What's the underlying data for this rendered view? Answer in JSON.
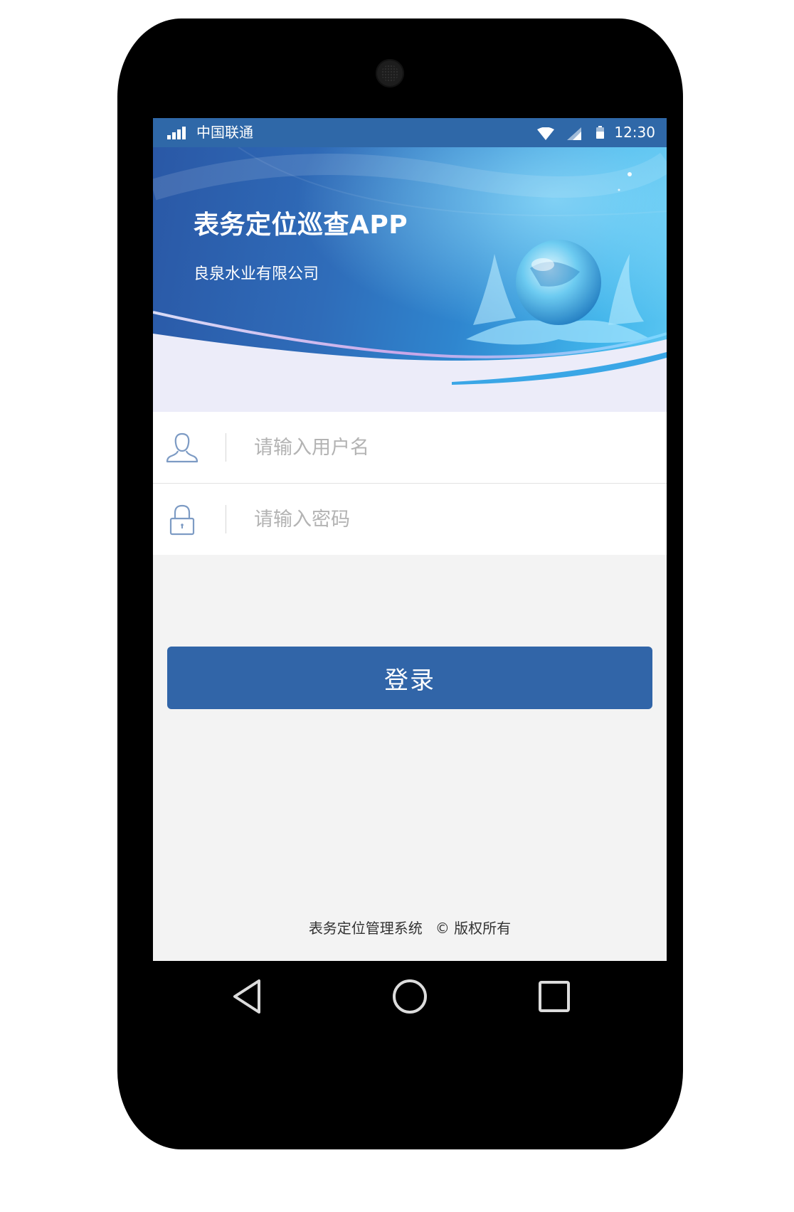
{
  "status_bar": {
    "carrier": "中国联通",
    "time": "12:30"
  },
  "banner": {
    "title": "表务定位巡查APP",
    "subtitle": "良泉水业有限公司"
  },
  "login_form": {
    "username_placeholder": "请输入用户名",
    "password_placeholder": "请输入密码",
    "username_value": "",
    "password_value": "",
    "login_label": "登录"
  },
  "footer": {
    "system_name": "表务定位管理系统",
    "copyright": "© 版权所有"
  },
  "icons": {
    "signal": "signal-bars-icon",
    "wifi": "wifi-icon",
    "cell": "cell-signal-icon",
    "battery": "battery-icon",
    "user": "user-icon",
    "lock": "lock-icon",
    "back": "back-triangle-icon",
    "home": "home-circle-icon",
    "recents": "recents-square-icon"
  },
  "colors": {
    "status_bar": "#2f68a8",
    "primary_button": "#3165a8",
    "background": "#f3f3f3",
    "icon_outline": "#7d9bc4"
  }
}
